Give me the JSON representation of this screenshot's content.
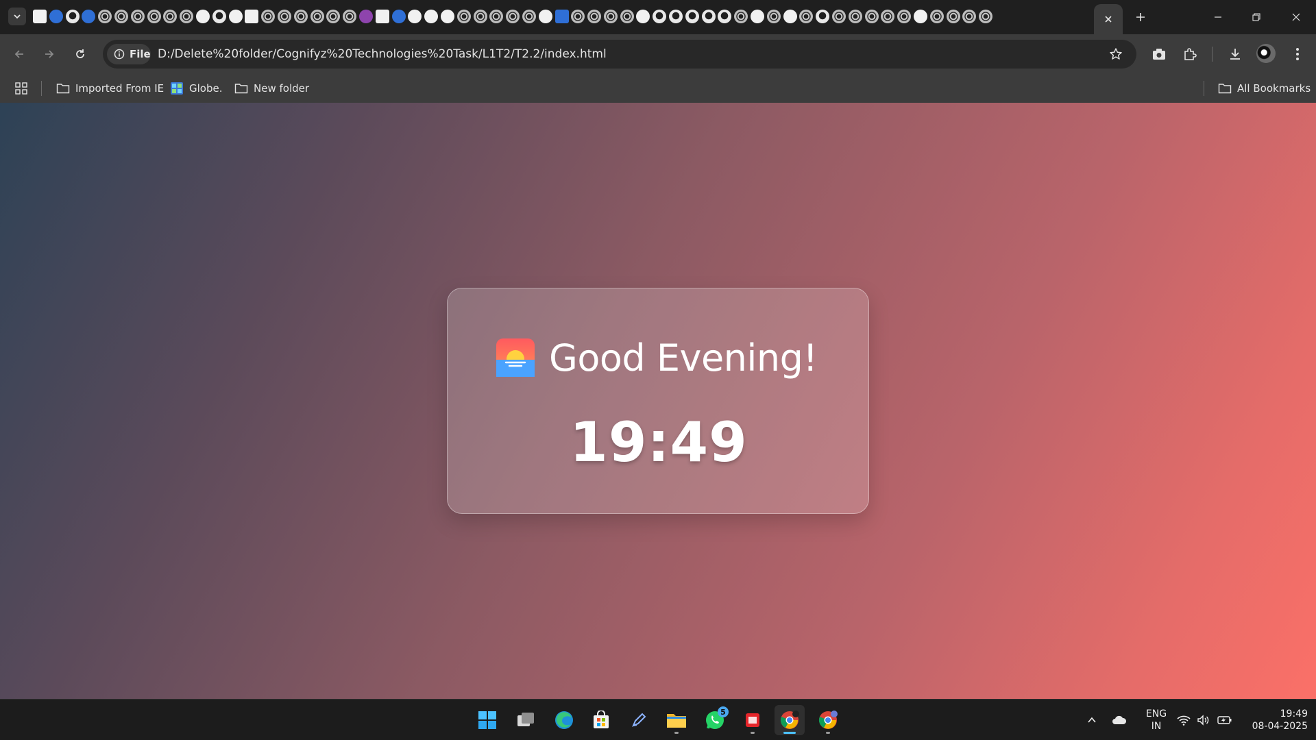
{
  "browser": {
    "address": {
      "chip_label": "File",
      "url": "D:/Delete%20folder/Cognifyz%20Technologies%20Task/L1T2/T2.2/index.html"
    },
    "bookmarks": [
      {
        "label": "Imported From IE",
        "icon": "folder-icon"
      },
      {
        "label": "Globe.",
        "icon": "globe-favicon"
      },
      {
        "label": "New folder",
        "icon": "folder-icon"
      }
    ],
    "all_bookmarks_label": "All Bookmarks"
  },
  "page": {
    "greeting": "Good Evening!",
    "time": "19:49",
    "greeting_icon": "sunset-icon",
    "background_colors": [
      "#2d4256",
      "#fb7068"
    ]
  },
  "taskbar": {
    "whatsapp_badge": "5",
    "language": "ENG",
    "region": "IN",
    "clock_time": "19:49",
    "clock_date": "08-04-2025"
  }
}
